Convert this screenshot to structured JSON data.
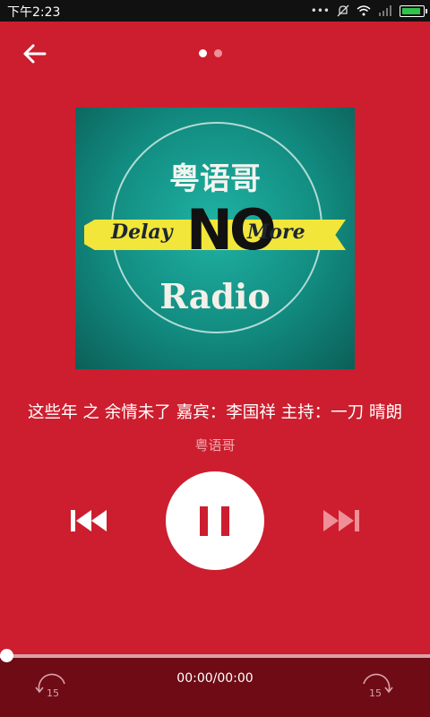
{
  "status_bar": {
    "time": "下午2:23"
  },
  "cover": {
    "title": "粤语哥",
    "banner_left": "Delay",
    "banner_center": "NO",
    "banner_right": "More",
    "subtitle": "Radio"
  },
  "track": {
    "title": "这些年 之 余情未了 嘉宾：李国祥 主持：一刀 晴朗",
    "artist": "粤语哥"
  },
  "player": {
    "state": "playing",
    "progress": 0,
    "time_display": "00:00/00:00",
    "skip_back_seconds": "15",
    "skip_forward_seconds": "15"
  },
  "pager": {
    "total": 2,
    "active": 1
  },
  "colors": {
    "background": "#cc1e2e",
    "bottom_panel": "#6e0b15",
    "artist_text": "#f1a9af"
  }
}
